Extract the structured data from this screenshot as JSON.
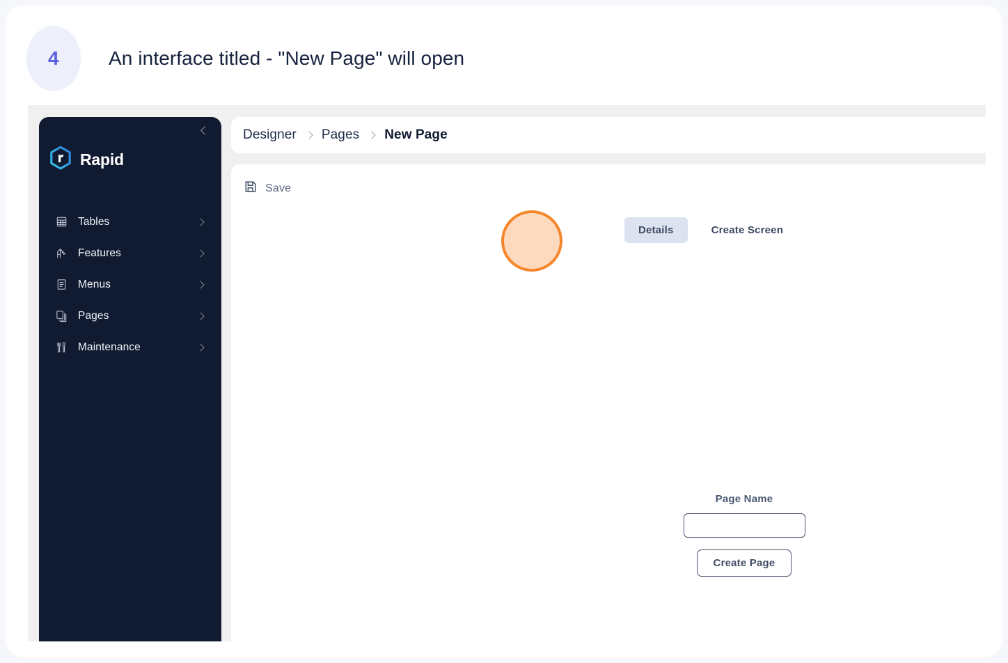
{
  "step": {
    "number": "4",
    "title": "An interface titled - \"New Page\" will open",
    "badge_bg": "#edf0fb",
    "badge_color": "#5b62e0"
  },
  "sidebar": {
    "brand": "Rapid",
    "collapse_icon": "chevron-left-icon",
    "background": "#101a31",
    "items": [
      {
        "label": "Tables",
        "icon": "table-icon"
      },
      {
        "label": "Features",
        "icon": "crane-icon"
      },
      {
        "label": "Menus",
        "icon": "document-lines-icon"
      },
      {
        "label": "Pages",
        "icon": "stacked-pages-icon"
      },
      {
        "label": "Maintenance",
        "icon": "tools-icon"
      }
    ]
  },
  "breadcrumb": {
    "items": [
      "Designer",
      "Pages",
      "New Page"
    ],
    "current_index": 2
  },
  "toolbar": {
    "save_label": "Save",
    "save_icon": "floppy-disk-icon"
  },
  "tabs": [
    {
      "label": "Details",
      "active": true
    },
    {
      "label": "Create Screen",
      "active": false
    }
  ],
  "form": {
    "page_name_label": "Page Name",
    "page_name_value": "",
    "page_name_placeholder": "",
    "create_button_label": "Create Page"
  },
  "highlight": {
    "color": "#f4872c",
    "fill": "rgba(250,178,120,0.48)"
  }
}
